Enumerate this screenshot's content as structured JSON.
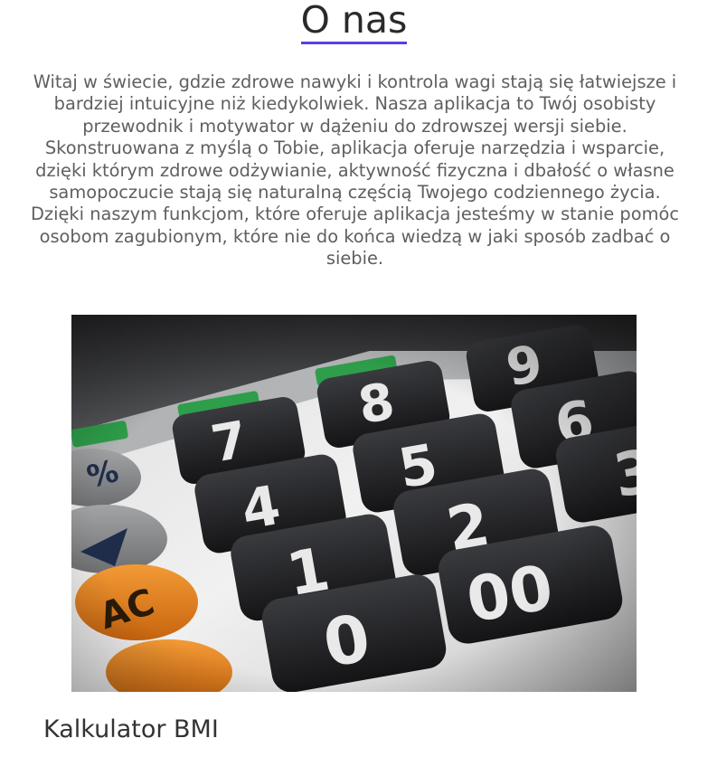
{
  "page": {
    "title": "O nas",
    "intro": "Witaj w świecie, gdzie zdrowe nawyki i kontrola wagi stają się łatwiejsze i bardziej intuicyjne niż kiedykolwiek. Nasza aplikacja to Twój osobisty przewodnik i motywator w dążeniu do zdrowszej wersji siebie. Skonstruowana z myślą o Tobie, aplikacja oferuje narzędzia i wsparcie, dzięki którym zdrowe odżywianie, aktywność fizyczna i dbałość o własne samopoczucie stają się naturalną częścią Twojego codziennego życia. Dzięki naszym funkcjom, które oferuje aplikacja jesteśmy w stanie pomóc osobom zagubionym, które nie do końca wiedzą w jaki sposób zadbać o siebie.",
    "section_heading": "Kalkulator BMI"
  },
  "hero_image": {
    "subject": "calculator-keypad-photo",
    "keys": {
      "k7": "7",
      "k8": "8",
      "k9": "9",
      "k4": "4",
      "k5": "5",
      "k6": "6",
      "k1": "1",
      "k2": "2",
      "k3": "3",
      "k0": "0",
      "k00": "00",
      "ac": "AC",
      "pct": "%"
    }
  },
  "colors": {
    "title_underline": "#5b3fe0",
    "text_gray": "#5f5f5f",
    "key_black": "#1f1f22",
    "key_orange": "#e8821c",
    "key_gray": "#8a8b8d",
    "key_green": "#2e9e4a"
  }
}
